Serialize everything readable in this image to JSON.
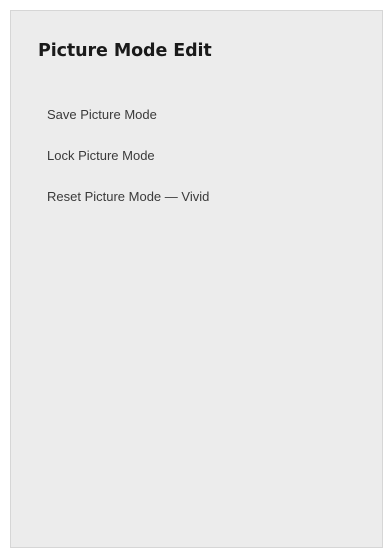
{
  "panel": {
    "title": "Picture Mode Edit",
    "items": [
      {
        "label": "Save Picture Mode"
      },
      {
        "label": "Lock Picture Mode"
      },
      {
        "label": "Reset Picture Mode — Vivid"
      }
    ]
  },
  "colors": {
    "panel_background": "#ececec",
    "title_text": "#1a1a1a",
    "item_text": "#3a3a3a"
  }
}
